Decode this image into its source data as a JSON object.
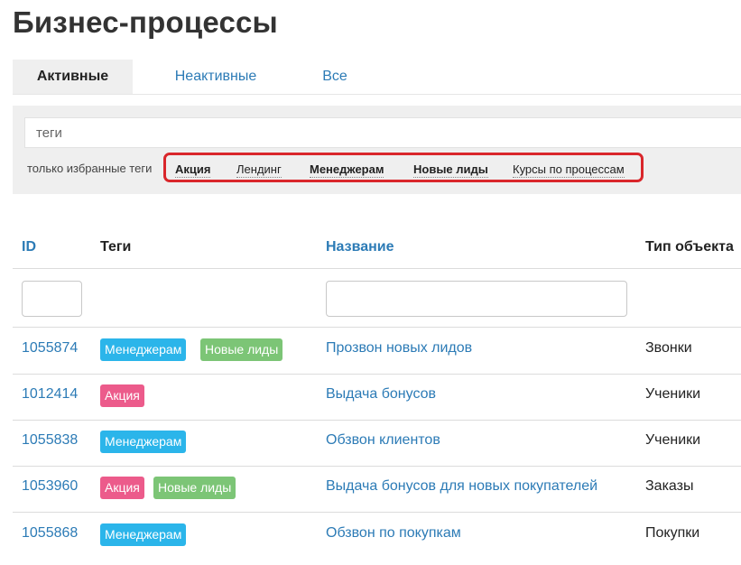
{
  "page": {
    "title": "Бизнес-процессы"
  },
  "tabs": [
    {
      "label": "Активные",
      "active": true
    },
    {
      "label": "Неактивные",
      "active": false
    },
    {
      "label": "Все",
      "active": false
    }
  ],
  "filters": {
    "tags_placeholder": "теги",
    "only_favorites_label": "только избранные теги",
    "favorite_tags": [
      {
        "label": "Акция",
        "bold": true
      },
      {
        "label": "Лендинг",
        "bold": false
      },
      {
        "label": "Менеджерам",
        "bold": true
      },
      {
        "label": "Новые лиды",
        "bold": true
      },
      {
        "label": "Курсы по процессам",
        "bold": false
      }
    ],
    "highlight_color": "#d9262b"
  },
  "table": {
    "columns": {
      "id": "ID",
      "tags": "Теги",
      "name": "Название",
      "object_type": "Тип объекта"
    },
    "rows": [
      {
        "id": "1055874",
        "tags": [
          {
            "label": "Менеджерам",
            "color": "#2bb5ea"
          },
          {
            "label": "Новые лиды",
            "color": "#7cc576"
          }
        ],
        "name": "Прозвон новых лидов",
        "type": "Звонки"
      },
      {
        "id": "1012414",
        "tags": [
          {
            "label": "Акция",
            "color": "#ec5b8b"
          }
        ],
        "name": "Выдача бонусов",
        "type": "Ученики"
      },
      {
        "id": "1055838",
        "tags": [
          {
            "label": "Менеджерам",
            "color": "#2bb5ea"
          }
        ],
        "name": "Обзвон клиентов",
        "type": "Ученики"
      },
      {
        "id": "1053960",
        "tags": [
          {
            "label": "Акция",
            "color": "#ec5b8b"
          },
          {
            "label": "Новые лиды",
            "color": "#7cc576"
          }
        ],
        "name": "Выдача бонусов для новых покупателей",
        "type": "Заказы"
      },
      {
        "id": "1055868",
        "tags": [
          {
            "label": "Менеджерам",
            "color": "#2bb5ea"
          }
        ],
        "name": "Обзвон по покупкам",
        "type": "Покупки"
      }
    ]
  },
  "colors": {
    "link": "#2c7bb6",
    "tab_active_bg": "#efefef",
    "panel_bg": "#efefef"
  }
}
